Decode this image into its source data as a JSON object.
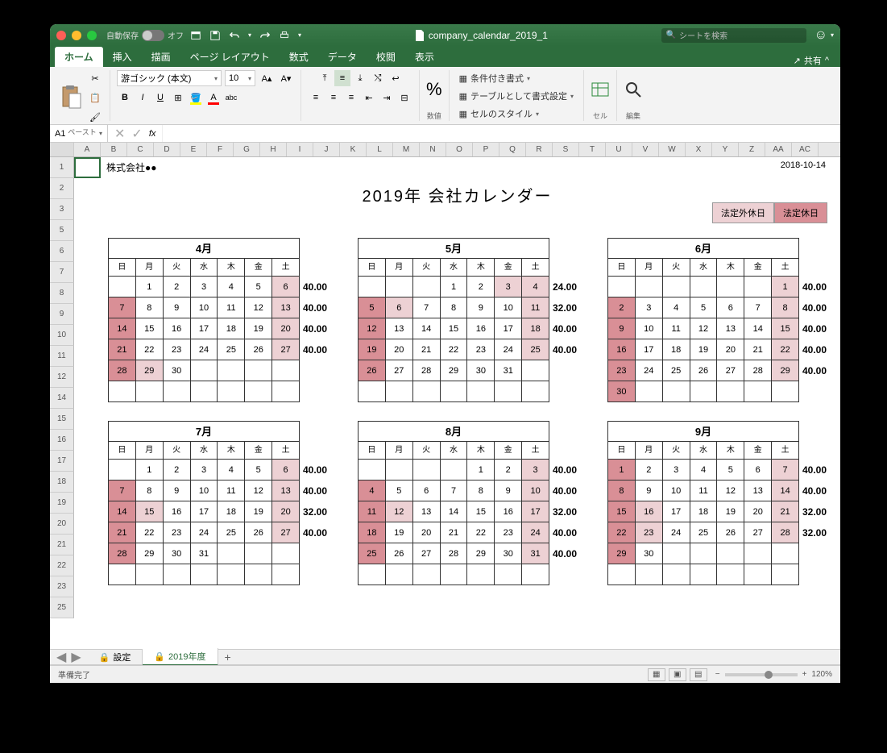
{
  "titlebar": {
    "autosave": "自動保存",
    "autosave_state": "オフ",
    "doc": "company_calendar_2019_1",
    "search_ph": "シートを検索"
  },
  "tabs": {
    "home": "ホーム",
    "insert": "挿入",
    "draw": "描画",
    "layout": "ページ レイアウト",
    "formulas": "数式",
    "data": "データ",
    "review": "校閲",
    "view": "表示",
    "share": "共有"
  },
  "ribbon": {
    "paste": "ペースト",
    "font": "游ゴシック (本文)",
    "size": "10",
    "number": "数値",
    "cond": "条件付き書式",
    "tablefmt": "テーブルとして書式設定",
    "cellstyle": "セルのスタイル",
    "cell": "セル",
    "edit": "編集"
  },
  "namebox": "A1",
  "cols": [
    "A",
    "B",
    "C",
    "D",
    "E",
    "F",
    "G",
    "H",
    "I",
    "J",
    "K",
    "L",
    "M",
    "N",
    "O",
    "P",
    "Q",
    "R",
    "S",
    "T",
    "U",
    "V",
    "W",
    "X",
    "Y",
    "Z",
    "AA",
    "AC"
  ],
  "rows": [
    "1",
    "2",
    "3",
    "5",
    "6",
    "7",
    "8",
    "9",
    "10",
    "11",
    "12",
    "14",
    "15",
    "16",
    "17",
    "18",
    "19",
    "20",
    "21",
    "22",
    "23",
    "25"
  ],
  "sheet": {
    "company": "株式会社●●",
    "date": "2018-10-14",
    "title": "2019年 会社カレンダー",
    "legend1": "法定外休日",
    "legend2": "法定休日",
    "weekdays": [
      "日",
      "月",
      "火",
      "水",
      "木",
      "金",
      "土"
    ]
  },
  "months": [
    {
      "name": "4月",
      "hours": [
        "40.00",
        "40.00",
        "40.00",
        "40.00"
      ],
      "rows": [
        [
          [
            "",
            ""
          ],
          [
            "1",
            ""
          ],
          [
            "2",
            ""
          ],
          [
            "3",
            ""
          ],
          [
            "4",
            ""
          ],
          [
            "5",
            ""
          ],
          [
            "6",
            "c1"
          ]
        ],
        [
          [
            "7",
            "c2"
          ],
          [
            "8",
            ""
          ],
          [
            "9",
            ""
          ],
          [
            "10",
            ""
          ],
          [
            "11",
            ""
          ],
          [
            "12",
            ""
          ],
          [
            "13",
            "c1"
          ]
        ],
        [
          [
            "14",
            "c2"
          ],
          [
            "15",
            ""
          ],
          [
            "16",
            ""
          ],
          [
            "17",
            ""
          ],
          [
            "18",
            ""
          ],
          [
            "19",
            ""
          ],
          [
            "20",
            "c1"
          ]
        ],
        [
          [
            "21",
            "c2"
          ],
          [
            "22",
            ""
          ],
          [
            "23",
            ""
          ],
          [
            "24",
            ""
          ],
          [
            "25",
            ""
          ],
          [
            "26",
            ""
          ],
          [
            "27",
            "c1"
          ]
        ],
        [
          [
            "28",
            "c2"
          ],
          [
            "29",
            "c1"
          ],
          [
            "30",
            ""
          ],
          [
            "",
            ""
          ],
          [
            "",
            ""
          ],
          [
            "",
            ""
          ],
          [
            "",
            ""
          ]
        ],
        [
          [
            "",
            ""
          ],
          [
            "",
            ""
          ],
          [
            "",
            ""
          ],
          [
            "",
            ""
          ],
          [
            "",
            ""
          ],
          [
            "",
            ""
          ],
          [
            "",
            ""
          ]
        ]
      ]
    },
    {
      "name": "5月",
      "hours": [
        "24.00",
        "32.00",
        "40.00",
        "40.00"
      ],
      "rows": [
        [
          [
            "",
            ""
          ],
          [
            "",
            ""
          ],
          [
            "",
            ""
          ],
          [
            "1",
            ""
          ],
          [
            "2",
            ""
          ],
          [
            "3",
            "c1"
          ],
          [
            "4",
            "c1"
          ]
        ],
        [
          [
            "5",
            "c2"
          ],
          [
            "6",
            "c1"
          ],
          [
            "7",
            ""
          ],
          [
            "8",
            ""
          ],
          [
            "9",
            ""
          ],
          [
            "10",
            ""
          ],
          [
            "11",
            "c1"
          ]
        ],
        [
          [
            "12",
            "c2"
          ],
          [
            "13",
            ""
          ],
          [
            "14",
            ""
          ],
          [
            "15",
            ""
          ],
          [
            "16",
            ""
          ],
          [
            "17",
            ""
          ],
          [
            "18",
            "c1"
          ]
        ],
        [
          [
            "19",
            "c2"
          ],
          [
            "20",
            ""
          ],
          [
            "21",
            ""
          ],
          [
            "22",
            ""
          ],
          [
            "23",
            ""
          ],
          [
            "24",
            ""
          ],
          [
            "25",
            "c1"
          ]
        ],
        [
          [
            "26",
            "c2"
          ],
          [
            "27",
            ""
          ],
          [
            "28",
            ""
          ],
          [
            "29",
            ""
          ],
          [
            "30",
            ""
          ],
          [
            "31",
            ""
          ],
          [
            "",
            ""
          ]
        ],
        [
          [
            "",
            ""
          ],
          [
            "",
            ""
          ],
          [
            "",
            ""
          ],
          [
            "",
            ""
          ],
          [
            "",
            ""
          ],
          [
            "",
            ""
          ],
          [
            "",
            ""
          ]
        ]
      ]
    },
    {
      "name": "6月",
      "hours": [
        "40.00",
        "40.00",
        "40.00",
        "40.00",
        "40.00"
      ],
      "rows": [
        [
          [
            "",
            ""
          ],
          [
            "",
            ""
          ],
          [
            "",
            ""
          ],
          [
            "",
            ""
          ],
          [
            "",
            ""
          ],
          [
            "",
            ""
          ],
          [
            "1",
            "c1"
          ]
        ],
        [
          [
            "2",
            "c2"
          ],
          [
            "3",
            ""
          ],
          [
            "4",
            ""
          ],
          [
            "5",
            ""
          ],
          [
            "6",
            ""
          ],
          [
            "7",
            ""
          ],
          [
            "8",
            "c1"
          ]
        ],
        [
          [
            "9",
            "c2"
          ],
          [
            "10",
            ""
          ],
          [
            "11",
            ""
          ],
          [
            "12",
            ""
          ],
          [
            "13",
            ""
          ],
          [
            "14",
            ""
          ],
          [
            "15",
            "c1"
          ]
        ],
        [
          [
            "16",
            "c2"
          ],
          [
            "17",
            ""
          ],
          [
            "18",
            ""
          ],
          [
            "19",
            ""
          ],
          [
            "20",
            ""
          ],
          [
            "21",
            ""
          ],
          [
            "22",
            "c1"
          ]
        ],
        [
          [
            "23",
            "c2"
          ],
          [
            "24",
            ""
          ],
          [
            "25",
            ""
          ],
          [
            "26",
            ""
          ],
          [
            "27",
            ""
          ],
          [
            "28",
            ""
          ],
          [
            "29",
            "c1"
          ]
        ],
        [
          [
            "30",
            "c2"
          ],
          [
            "",
            ""
          ],
          [
            "",
            ""
          ],
          [
            "",
            ""
          ],
          [
            "",
            ""
          ],
          [
            "",
            ""
          ],
          [
            "",
            ""
          ]
        ]
      ]
    },
    {
      "name": "7月",
      "hours": [
        "40.00",
        "40.00",
        "32.00",
        "40.00"
      ],
      "rows": [
        [
          [
            "",
            ""
          ],
          [
            "1",
            ""
          ],
          [
            "2",
            ""
          ],
          [
            "3",
            ""
          ],
          [
            "4",
            ""
          ],
          [
            "5",
            ""
          ],
          [
            "6",
            "c1"
          ]
        ],
        [
          [
            "7",
            "c2"
          ],
          [
            "8",
            ""
          ],
          [
            "9",
            ""
          ],
          [
            "10",
            ""
          ],
          [
            "11",
            ""
          ],
          [
            "12",
            ""
          ],
          [
            "13",
            "c1"
          ]
        ],
        [
          [
            "14",
            "c2"
          ],
          [
            "15",
            "c1"
          ],
          [
            "16",
            ""
          ],
          [
            "17",
            ""
          ],
          [
            "18",
            ""
          ],
          [
            "19",
            ""
          ],
          [
            "20",
            "c1"
          ]
        ],
        [
          [
            "21",
            "c2"
          ],
          [
            "22",
            ""
          ],
          [
            "23",
            ""
          ],
          [
            "24",
            ""
          ],
          [
            "25",
            ""
          ],
          [
            "26",
            ""
          ],
          [
            "27",
            "c1"
          ]
        ],
        [
          [
            "28",
            "c2"
          ],
          [
            "29",
            ""
          ],
          [
            "30",
            ""
          ],
          [
            "31",
            ""
          ],
          [
            "",
            ""
          ],
          [
            "",
            ""
          ],
          [
            "",
            ""
          ]
        ],
        [
          [
            "",
            ""
          ],
          [
            "",
            ""
          ],
          [
            "",
            ""
          ],
          [
            "",
            ""
          ],
          [
            "",
            ""
          ],
          [
            "",
            ""
          ],
          [
            "",
            ""
          ]
        ]
      ]
    },
    {
      "name": "8月",
      "hours": [
        "40.00",
        "40.00",
        "32.00",
        "40.00",
        "40.00"
      ],
      "rows": [
        [
          [
            "",
            ""
          ],
          [
            "",
            ""
          ],
          [
            "",
            ""
          ],
          [
            "",
            ""
          ],
          [
            "1",
            ""
          ],
          [
            "2",
            ""
          ],
          [
            "3",
            "c1"
          ]
        ],
        [
          [
            "4",
            "c2"
          ],
          [
            "5",
            ""
          ],
          [
            "6",
            ""
          ],
          [
            "7",
            ""
          ],
          [
            "8",
            ""
          ],
          [
            "9",
            ""
          ],
          [
            "10",
            "c1"
          ]
        ],
        [
          [
            "11",
            "c2"
          ],
          [
            "12",
            "c1"
          ],
          [
            "13",
            ""
          ],
          [
            "14",
            ""
          ],
          [
            "15",
            ""
          ],
          [
            "16",
            ""
          ],
          [
            "17",
            "c1"
          ]
        ],
        [
          [
            "18",
            "c2"
          ],
          [
            "19",
            ""
          ],
          [
            "20",
            ""
          ],
          [
            "21",
            ""
          ],
          [
            "22",
            ""
          ],
          [
            "23",
            ""
          ],
          [
            "24",
            "c1"
          ]
        ],
        [
          [
            "25",
            "c2"
          ],
          [
            "26",
            ""
          ],
          [
            "27",
            ""
          ],
          [
            "28",
            ""
          ],
          [
            "29",
            ""
          ],
          [
            "30",
            ""
          ],
          [
            "31",
            "c1"
          ]
        ],
        [
          [
            "",
            ""
          ],
          [
            "",
            ""
          ],
          [
            "",
            ""
          ],
          [
            "",
            ""
          ],
          [
            "",
            ""
          ],
          [
            "",
            ""
          ],
          [
            "",
            ""
          ]
        ]
      ]
    },
    {
      "name": "9月",
      "hours": [
        "40.00",
        "40.00",
        "32.00",
        "32.00"
      ],
      "rows": [
        [
          [
            "1",
            "c2"
          ],
          [
            "2",
            ""
          ],
          [
            "3",
            ""
          ],
          [
            "4",
            ""
          ],
          [
            "5",
            ""
          ],
          [
            "6",
            ""
          ],
          [
            "7",
            "c1"
          ]
        ],
        [
          [
            "8",
            "c2"
          ],
          [
            "9",
            ""
          ],
          [
            "10",
            ""
          ],
          [
            "11",
            ""
          ],
          [
            "12",
            ""
          ],
          [
            "13",
            ""
          ],
          [
            "14",
            "c1"
          ]
        ],
        [
          [
            "15",
            "c2"
          ],
          [
            "16",
            "c1"
          ],
          [
            "17",
            ""
          ],
          [
            "18",
            ""
          ],
          [
            "19",
            ""
          ],
          [
            "20",
            ""
          ],
          [
            "21",
            "c1"
          ]
        ],
        [
          [
            "22",
            "c2"
          ],
          [
            "23",
            "c1"
          ],
          [
            "24",
            ""
          ],
          [
            "25",
            ""
          ],
          [
            "26",
            ""
          ],
          [
            "27",
            ""
          ],
          [
            "28",
            "c1"
          ]
        ],
        [
          [
            "29",
            "c2"
          ],
          [
            "30",
            ""
          ],
          [
            "",
            ""
          ],
          [
            "",
            ""
          ],
          [
            "",
            ""
          ],
          [
            "",
            ""
          ],
          [
            "",
            ""
          ]
        ],
        [
          [
            "",
            ""
          ],
          [
            "",
            ""
          ],
          [
            "",
            ""
          ],
          [
            "",
            ""
          ],
          [
            "",
            ""
          ],
          [
            "",
            ""
          ],
          [
            "",
            ""
          ]
        ]
      ]
    }
  ],
  "sheettabs": {
    "settings": "設定",
    "fy": "2019年度"
  },
  "status": {
    "ready": "準備完了",
    "zoom": "120%"
  }
}
